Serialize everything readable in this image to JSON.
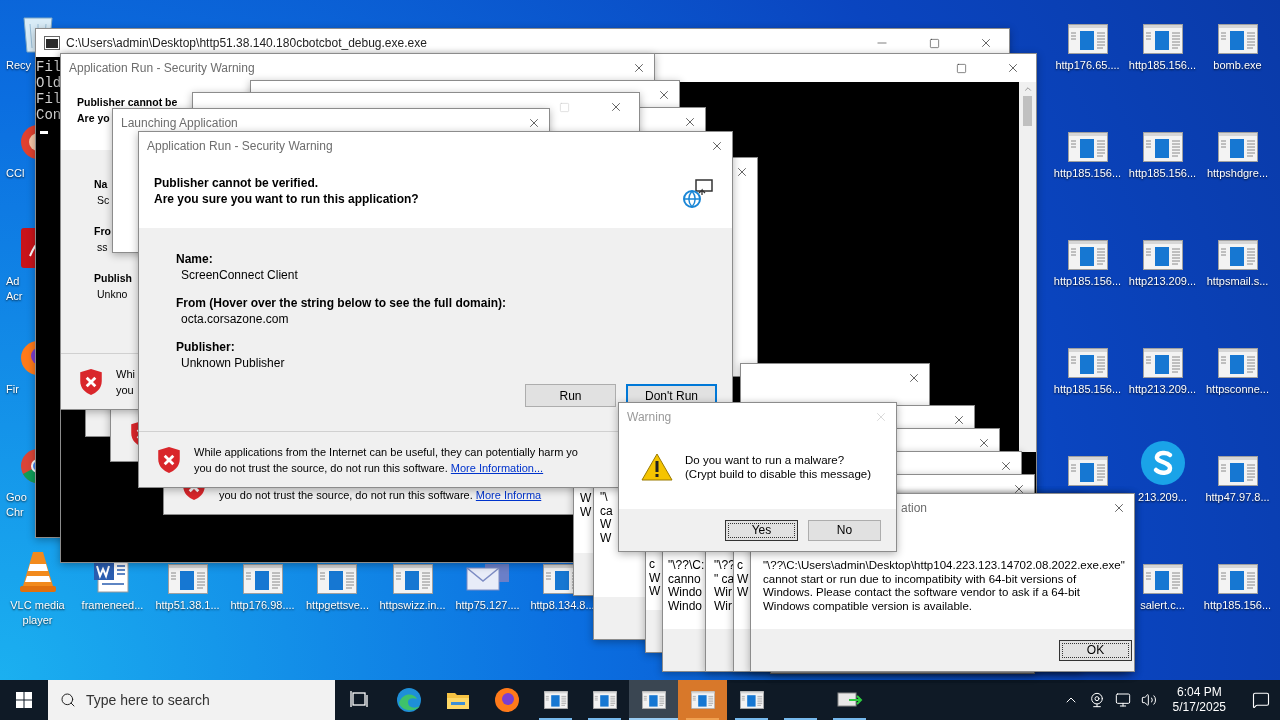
{
  "desktop": {
    "left_icons": [
      {
        "kind": "recycle_bin",
        "label": "Recy"
      },
      {
        "kind": "cleaner",
        "label": "CCl"
      },
      {
        "kind": "pdf",
        "label": "Ad Acr"
      },
      {
        "kind": "firefox",
        "label": "Fir"
      },
      {
        "kind": "chrome",
        "label": "Goo Chr"
      },
      {
        "kind": "vlc",
        "label": "VLC media player"
      }
    ],
    "bottom_icons": [
      {
        "kind": "word",
        "label": "frameneed..."
      },
      {
        "kind": "program",
        "label": "http51.38.1..."
      },
      {
        "kind": "program",
        "label": "http176.98...."
      },
      {
        "kind": "program",
        "label": "httpgettsve..."
      },
      {
        "kind": "program",
        "label": "httpswizz.in..."
      },
      {
        "kind": "mail",
        "label": "http75.127...."
      },
      {
        "kind": "program",
        "label": "http8.134.8..."
      }
    ],
    "right_columns": [
      [
        {
          "kind": "program",
          "label": "http176.65...."
        },
        {
          "kind": "program",
          "label": "http185.156..."
        },
        {
          "kind": "program",
          "label": "http185.156..."
        },
        {
          "kind": "program",
          "label": "http185.156..."
        },
        {
          "kind": "program"
        }
      ],
      [
        {
          "kind": "program",
          "label": "http185.156..."
        },
        {
          "kind": "program",
          "label": "http185.156..."
        },
        {
          "kind": "program",
          "label": "http213.209..."
        },
        {
          "kind": "program",
          "label": "http213.209..."
        },
        {
          "kind": "skype",
          "label": "213.209..."
        },
        {
          "kind": "program",
          "label": "salert.c..."
        }
      ],
      [
        {
          "kind": "program",
          "label": "bomb.exe"
        },
        {
          "kind": "program",
          "label": "httpshdgre..."
        },
        {
          "kind": "program",
          "label": "httpsmail.s..."
        },
        {
          "kind": "program",
          "label": "httpsconne..."
        },
        {
          "kind": "program",
          "label": "http47.97.8..."
        },
        {
          "kind": "program",
          "label": "http185.156..."
        }
      ]
    ]
  },
  "console_window": {
    "title": "C:\\Users\\admin\\Desktop\\http51.38.140.180cbotcbot_debug.exe.exe",
    "lines": [
      "Fil",
      "Old",
      "Fil",
      "Con"
    ],
    "cursor": true
  },
  "background_warning": {
    "title": "Application Run - Security Warning",
    "header": [
      "Publisher cannot be",
      "Are yo"
    ],
    "fields": [
      {
        "label": "Na",
        "value": "Sc"
      },
      {
        "label": "Fro",
        "value": "ss"
      },
      {
        "label": "Publish",
        "value": "Unkno"
      }
    ],
    "footer": [
      "Whi",
      "you"
    ]
  },
  "launching_window": {
    "title": "Launching Application"
  },
  "fragment_notice": {
    "text": "you do not trust the source, do not run this software.",
    "link": "More Informa"
  },
  "security_dialog": {
    "title": "Application Run - Security Warning",
    "header": [
      "Publisher cannot be verified.",
      "Are you sure you want to run this application?"
    ],
    "fields": [
      {
        "label": "Name:",
        "value": "ScreenConnect Client"
      },
      {
        "label": "From (Hover over the string below to see the full domain):",
        "value": "octa.corsazone.com"
      },
      {
        "label": "Publisher:",
        "value": "Unknown Publisher"
      }
    ],
    "buttons": [
      {
        "label": "Run",
        "focused": false
      },
      {
        "label": "Don't Run",
        "focused": true
      }
    ],
    "footer": {
      "line1": "While applications from the Internet can be useful, they can potentially harm yo",
      "line2": "you do not trust the source, do not run this software.",
      "link": "More Information..."
    }
  },
  "error_windows": [
    {
      "kind": "partial",
      "lines": [
        "W",
        "W"
      ]
    },
    {
      "kind": "partial",
      "lines": [
        "\"\\",
        "ca",
        "W",
        "W"
      ]
    },
    {
      "kind": "partial",
      "lines": [
        "c",
        "W",
        "W"
      ]
    },
    {
      "kind": "partial",
      "lines": [
        "\"\\??\\C:",
        "canno",
        "Windo",
        "Windo"
      ]
    },
    {
      "kind": "partial",
      "lines": [
        "\"\\??",
        "\" ca",
        "Wir",
        "Wir"
      ]
    },
    {
      "kind": "partial",
      "lines": [
        "c",
        "W",
        "W"
      ]
    },
    {
      "kind": "front",
      "title": "ation",
      "lines": [
        "\"\\??\\C:\\Users\\admin\\Desktop\\http104.223.123.14702.08.2022.exe.exe\"",
        "cannot start or run due to incompatibity with 64-bit versions of",
        "Windows. Please contact the software vendor to ask if a 64-bit",
        "Windows compatible version is available."
      ],
      "button": "OK"
    }
  ],
  "warning_dialog": {
    "title": "Warning",
    "lines": [
      "Do you want to run a malware?",
      "(Crypt build to disable this message)"
    ],
    "buttons": [
      {
        "label": "Yes",
        "focused": true
      },
      {
        "label": "No",
        "focused": false
      }
    ]
  },
  "taskbar": {
    "search": {
      "placeholder": "Type here to search"
    },
    "buttons": [
      {
        "kind": "task_view",
        "running": false,
        "selected": false,
        "attention": false
      },
      {
        "kind": "edge",
        "running": false,
        "selected": false,
        "attention": false
      },
      {
        "kind": "folder",
        "running": false,
        "selected": false,
        "attention": false
      },
      {
        "kind": "firefox",
        "running": false,
        "selected": false,
        "attention": false
      },
      {
        "kind": "program",
        "running": true,
        "selected": false,
        "attention": false
      },
      {
        "kind": "program",
        "running": true,
        "selected": false,
        "attention": false
      },
      {
        "kind": "program",
        "running": true,
        "selected": true,
        "attention": false
      },
      {
        "kind": "program",
        "running": true,
        "selected": false,
        "attention": true
      },
      {
        "kind": "program",
        "running": true,
        "selected": false,
        "attention": false
      },
      {
        "kind": "blank",
        "running": true,
        "selected": false,
        "attention": false
      },
      {
        "kind": "network",
        "running": true,
        "selected": false,
        "attention": false
      }
    ],
    "clock": {
      "time": "6:04 PM",
      "date": "5/17/2025"
    }
  }
}
